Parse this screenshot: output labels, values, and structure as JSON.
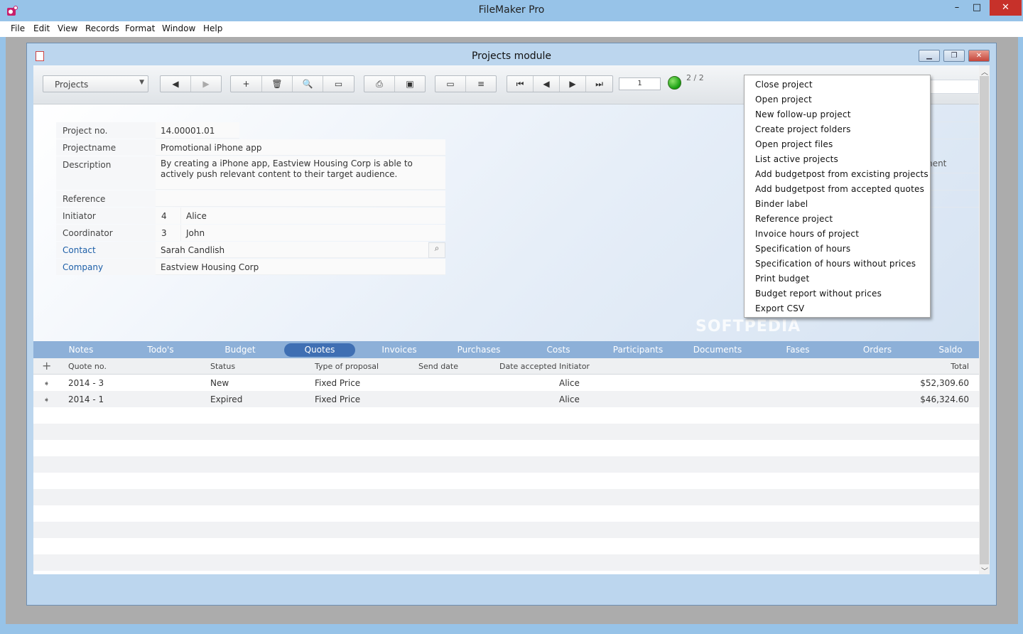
{
  "app": {
    "title": "FileMaker Pro",
    "min": "–",
    "max": "□",
    "close": "✕"
  },
  "menus": [
    "File",
    "Edit",
    "View",
    "Records",
    "Format",
    "Window",
    "Help"
  ],
  "window": {
    "title": "Projects module"
  },
  "toolbar": {
    "layout": "Projects",
    "record_number": "1",
    "record_counter": "2 / 2",
    "nav_icons": [
      "◀",
      "▶"
    ],
    "record_icons": [
      "+",
      "🗑",
      "🔍",
      "▭"
    ],
    "print_icons": [
      "⎙",
      "▣"
    ],
    "view_icons": [
      "▭",
      "≡"
    ],
    "browse_icons": [
      "⏮",
      "◀",
      "▶",
      "⏭"
    ]
  },
  "form": {
    "project_no_label": "Project no.",
    "project_no": "14.00001.01",
    "projectname_label": "Projectname",
    "projectname": "Promotional iPhone app",
    "description_label": "Description",
    "description": "By creating a iPhone app, Eastview Housing Corp is able to actively push relevant content to their target audience.",
    "reference_label": "Reference",
    "reference": "",
    "initiator_label": "Initiator",
    "initiator_no": "4",
    "initiator_name": "Alice",
    "coordinator_label": "Coordinator",
    "coordinator_no": "3",
    "coordinator_name": "John",
    "contact_label": "Contact",
    "contact": "Sarah Candlish",
    "company_label": "Company",
    "company": "Eastview Housing Corp"
  },
  "partial_label": "ment",
  "watermark": "SOFTPEDIA",
  "tabs": [
    "Notes",
    "Todo's",
    "Budget",
    "Quotes",
    "Invoices",
    "Purchases",
    "Costs",
    "Participants",
    "Documents",
    "Fases",
    "Orders",
    "Saldo"
  ],
  "active_tab": "Quotes",
  "quotes": {
    "add": "+",
    "headers": {
      "quote_no": "Quote no.",
      "status": "Status",
      "type": "Type of proposal",
      "send_date": "Send date",
      "date_accepted": "Date accepted",
      "initiator": "Initiator",
      "total": "Total"
    },
    "rows": [
      {
        "quote_no": "2014 - 3",
        "status": "New",
        "type": "Fixed Price",
        "send_date": "",
        "date_accepted": "",
        "initiator": "Alice",
        "total": "$52,309.60"
      },
      {
        "quote_no": "2014 - 1",
        "status": "Expired",
        "type": "Fixed Price",
        "send_date": "",
        "date_accepted": "",
        "initiator": "Alice",
        "total": "$46,324.60"
      }
    ]
  },
  "context_menu": [
    "Close project",
    "Open project",
    "New follow-up project",
    "Create project folders",
    "Open project files",
    "List active projects",
    "Add budgetpost from excisting projects",
    "Add budgetpost from accepted quotes",
    "Binder label",
    "Reference project",
    "Invoice hours of project",
    "Specification of hours",
    "Specification of hours without prices",
    "Print budget",
    "Budget report without prices",
    "Export  CSV"
  ],
  "colors": {
    "title_bar": "#97c3e8",
    "tab_bar": "#8db0d8",
    "active_tab": "#3f6fb3",
    "link": "#1d5fa8",
    "status_dot": "#1ea51a"
  }
}
